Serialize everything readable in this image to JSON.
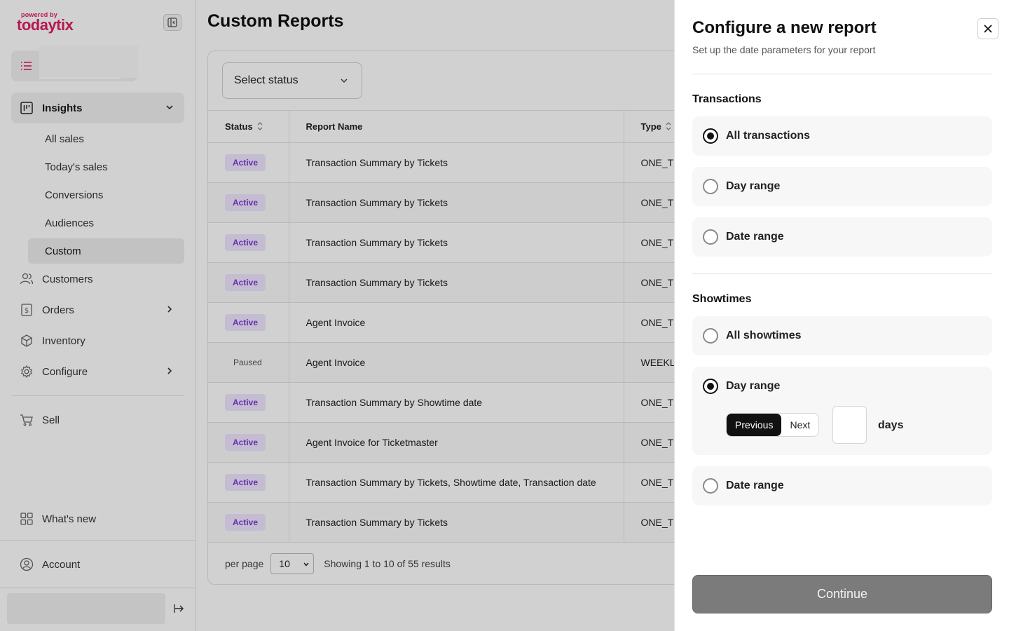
{
  "brand": {
    "powered_by": "powered by",
    "name": "todaytix",
    "color": "#e11d63"
  },
  "sidebar": {
    "insights": "Insights",
    "insights_sub": [
      "All sales",
      "Today's sales",
      "Conversions",
      "Audiences",
      "Custom"
    ],
    "customers": "Customers",
    "orders": "Orders",
    "inventory": "Inventory",
    "configure": "Configure",
    "sell": "Sell",
    "whats_new": "What's new",
    "account": "Account"
  },
  "main": {
    "title": "Custom Reports",
    "status_filter": "Select status",
    "columns": {
      "status": "Status",
      "report_name": "Report Name",
      "type": "Type"
    },
    "rows": [
      {
        "status": "Active",
        "name": "Transaction Summary by Tickets",
        "type": "ONE_TI"
      },
      {
        "status": "Active",
        "name": "Transaction Summary by Tickets",
        "type": "ONE_TI"
      },
      {
        "status": "Active",
        "name": "Transaction Summary by Tickets",
        "type": "ONE_TI"
      },
      {
        "status": "Active",
        "name": "Transaction Summary by Tickets",
        "type": "ONE_TI"
      },
      {
        "status": "Active",
        "name": "Agent Invoice",
        "type": "ONE_TI"
      },
      {
        "status": "Paused",
        "name": "Agent Invoice",
        "type": "WEEKLY"
      },
      {
        "status": "Active",
        "name": "Transaction Summary by Showtime date",
        "type": "ONE_TI"
      },
      {
        "status": "Active",
        "name": "Agent Invoice for Ticketmaster",
        "type": "ONE_TI"
      },
      {
        "status": "Active",
        "name": "Transaction Summary by Tickets, Showtime date, Transaction date",
        "type": "ONE_TI"
      },
      {
        "status": "Active",
        "name": "Transaction Summary by Tickets",
        "type": "ONE_TI"
      }
    ],
    "pager": {
      "per_page_label": "per page",
      "per_page": "10",
      "info": "Showing 1 to 10 of 55 results"
    }
  },
  "drawer": {
    "title": "Configure a new report",
    "subtitle": "Set up the date parameters for your report",
    "transactions": {
      "title": "Transactions",
      "options": [
        "All transactions",
        "Day range",
        "Date range"
      ],
      "selected": 0
    },
    "showtimes": {
      "title": "Showtimes",
      "options": [
        "All showtimes",
        "Day range",
        "Date range"
      ],
      "selected": 1,
      "segment": [
        "Previous",
        "Next"
      ],
      "segment_selected": 0,
      "days_value": "",
      "days_label": "days"
    },
    "continue": "Continue"
  }
}
